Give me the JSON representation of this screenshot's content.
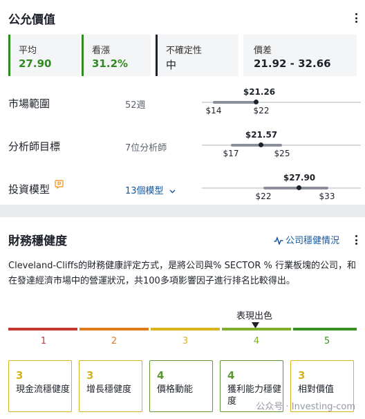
{
  "fair_value": {
    "title": "公允價值",
    "metrics": [
      {
        "label": "平均",
        "value": "27.90",
        "color": "#2e8b1f"
      },
      {
        "label": "看漲",
        "value": "31.2%",
        "color": "#2e8b1f"
      },
      {
        "label": "不確定性",
        "value": "中",
        "color": "#1d2129"
      },
      {
        "label": "價差",
        "value": "21.92 - 32.66",
        "color": "#1d2129"
      }
    ],
    "rows": [
      {
        "label": "市場範圍",
        "sub": "52週",
        "current": "$21.26",
        "low": "$14",
        "high": "$22"
      },
      {
        "label": "分析師目標",
        "sub": "7位分析師",
        "current": "$21.57",
        "low": "$17",
        "high": "$25"
      },
      {
        "label": "投資模型",
        "sub": "13個模型",
        "current": "$27.90",
        "low": "$22",
        "high": "$33"
      }
    ]
  },
  "health": {
    "title": "財務穩健度",
    "link_label": "公司穩健情況",
    "description": "Cleveland-Cliffs的財務健康評定方式，是將公司與% SECTOR % 行業板塊的公司，和在發達經濟市場中的營運狀況，共100多項影響因子進行排名比較得出。",
    "scale_caption": "表現出色",
    "scale": [
      {
        "n": "1",
        "color": "#c7362e"
      },
      {
        "n": "2",
        "color": "#e07b1a"
      },
      {
        "n": "3",
        "color": "#d9b31c"
      },
      {
        "n": "4",
        "color": "#7fae2c"
      },
      {
        "n": "5",
        "color": "#3a8e23"
      }
    ],
    "cards": [
      {
        "score": "3",
        "label": "現金流穩健度",
        "color": "#d9b31c"
      },
      {
        "score": "3",
        "label": "增長穩健度",
        "color": "#d9b31c"
      },
      {
        "score": "4",
        "label": "價格動能",
        "color": "#5d9632"
      },
      {
        "score": "4",
        "label": "獲利能力穩健度",
        "color": "#5d9632"
      },
      {
        "score": "3",
        "label": "相對價值",
        "color": "#d9b31c"
      }
    ]
  },
  "watermark": "公众号 · Investing-com",
  "colors": {
    "link": "#1256a0",
    "model_icon": "#f39c2c"
  }
}
